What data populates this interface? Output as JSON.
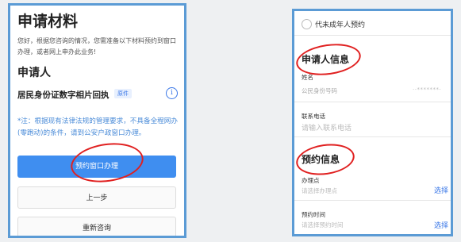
{
  "left": {
    "title": "申请材料",
    "intro": "您好，根据您咨询的情况，您需准备以下材料预约到窗口办理，或者网上申办此业务!",
    "applicant_heading": "申请人",
    "photo_item": "居民身份证数字相片回执",
    "photo_badge": "原件",
    "info_icon": "i",
    "note": "*注：根据现有法律法规的管理要求，不具备全程网办(零跑动)的条件，请到公安户政窗口办理。",
    "primary_button": "预约窗口办理",
    "prev_button": "上一步",
    "reset_button": "重新咨询"
  },
  "right": {
    "minor_option": "代未成年人预约",
    "applicant_info_heading": "申请人信息",
    "name_label": "姓名",
    "id_label": "公民身份号码",
    "id_value_masked": "··*******·",
    "phone_label": "联系电话",
    "phone_placeholder": "请输入联系电话",
    "appointment_heading": "预约信息",
    "office_label": "办理点",
    "office_placeholder": "请选择办理点",
    "office_select": "选择",
    "time_label": "预约时间",
    "time_placeholder": "请选择预约时间",
    "time_select": "选择"
  },
  "colors": {
    "accent_blue": "#3f8ef0",
    "frame_blue": "#5b9bd5",
    "annotation_red": "#e02020"
  }
}
